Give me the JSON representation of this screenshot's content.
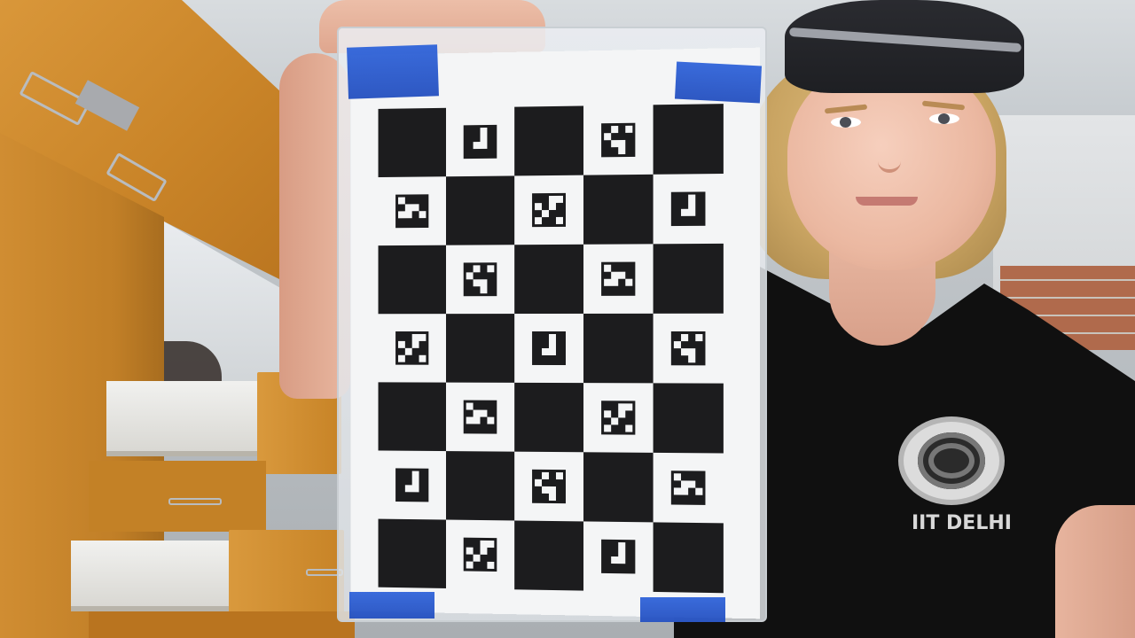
{
  "shirt": {
    "logo_text": "IIT DELHI"
  },
  "board": {
    "type": "charuco",
    "rows": 7,
    "cols": 5
  },
  "colors": {
    "tape": "#2f63d9",
    "shirt": "#101010",
    "cabinet": "#c98428"
  }
}
